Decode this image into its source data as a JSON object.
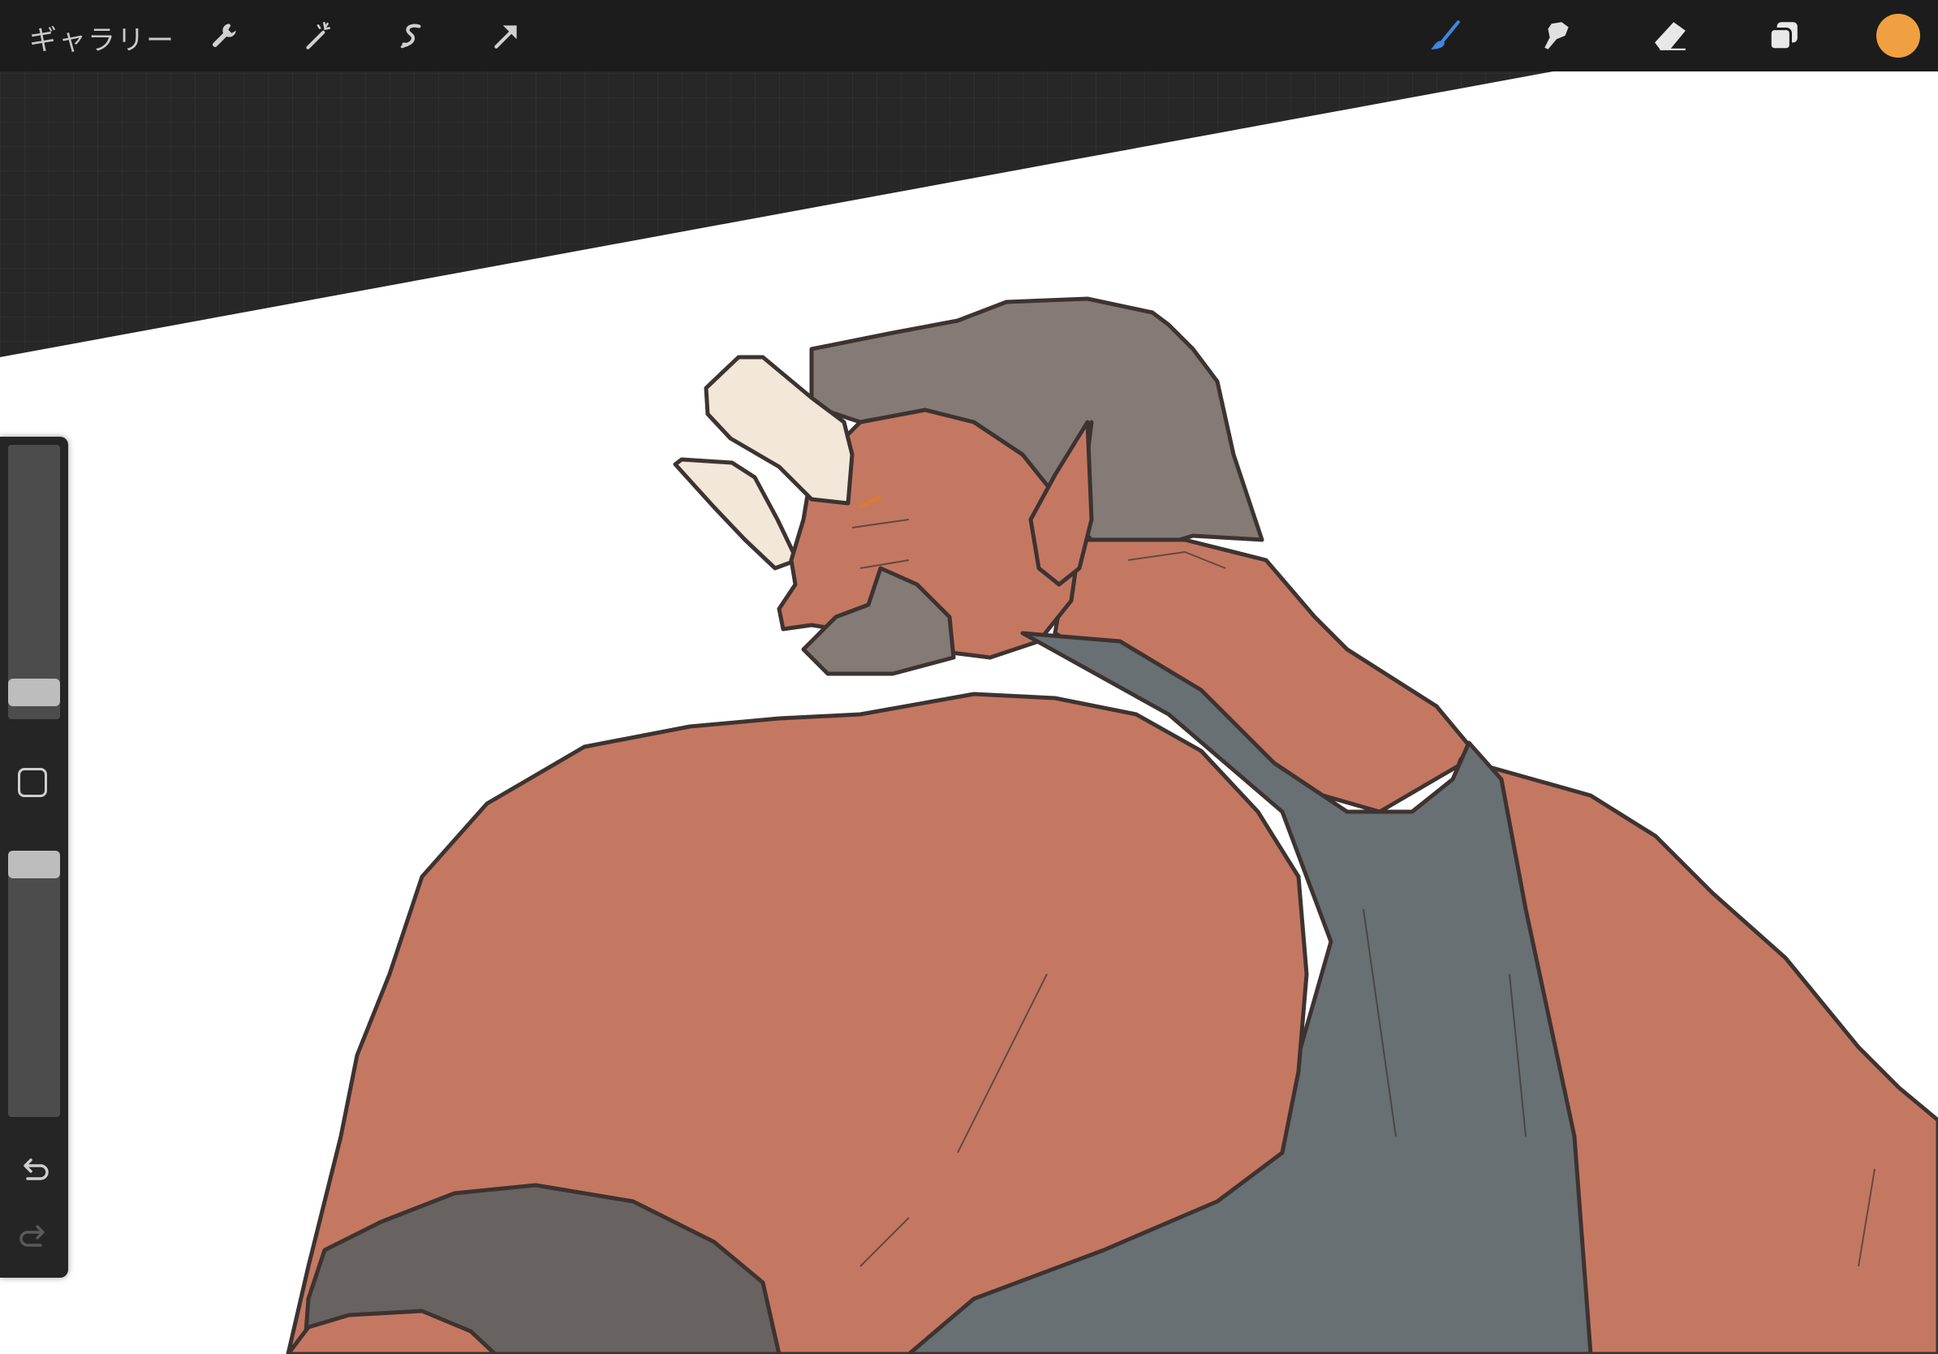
{
  "toolbar": {
    "gallery_label": "ギャラリー",
    "left_tools": [
      "wrench-icon",
      "magic-wand-icon",
      "selection-icon",
      "transform-arrow-icon"
    ],
    "right_tools": [
      "brush-icon",
      "smudge-icon",
      "eraser-icon",
      "layers-icon"
    ],
    "active_tool": "brush-icon",
    "current_color": "#f0a040"
  },
  "sidebar": {
    "brush_size_level": 0.12,
    "brush_opacity_level": 0.98,
    "buttons": [
      "modify-square-icon",
      "undo-icon",
      "redo-icon"
    ]
  },
  "colors": {
    "skin": "#c47862",
    "hair": "#847a76",
    "tanktop": "#687074",
    "horn": "#f2e7d8",
    "armband": "#686260",
    "line": "#3d3331",
    "active_accent": "#3f86e0"
  }
}
